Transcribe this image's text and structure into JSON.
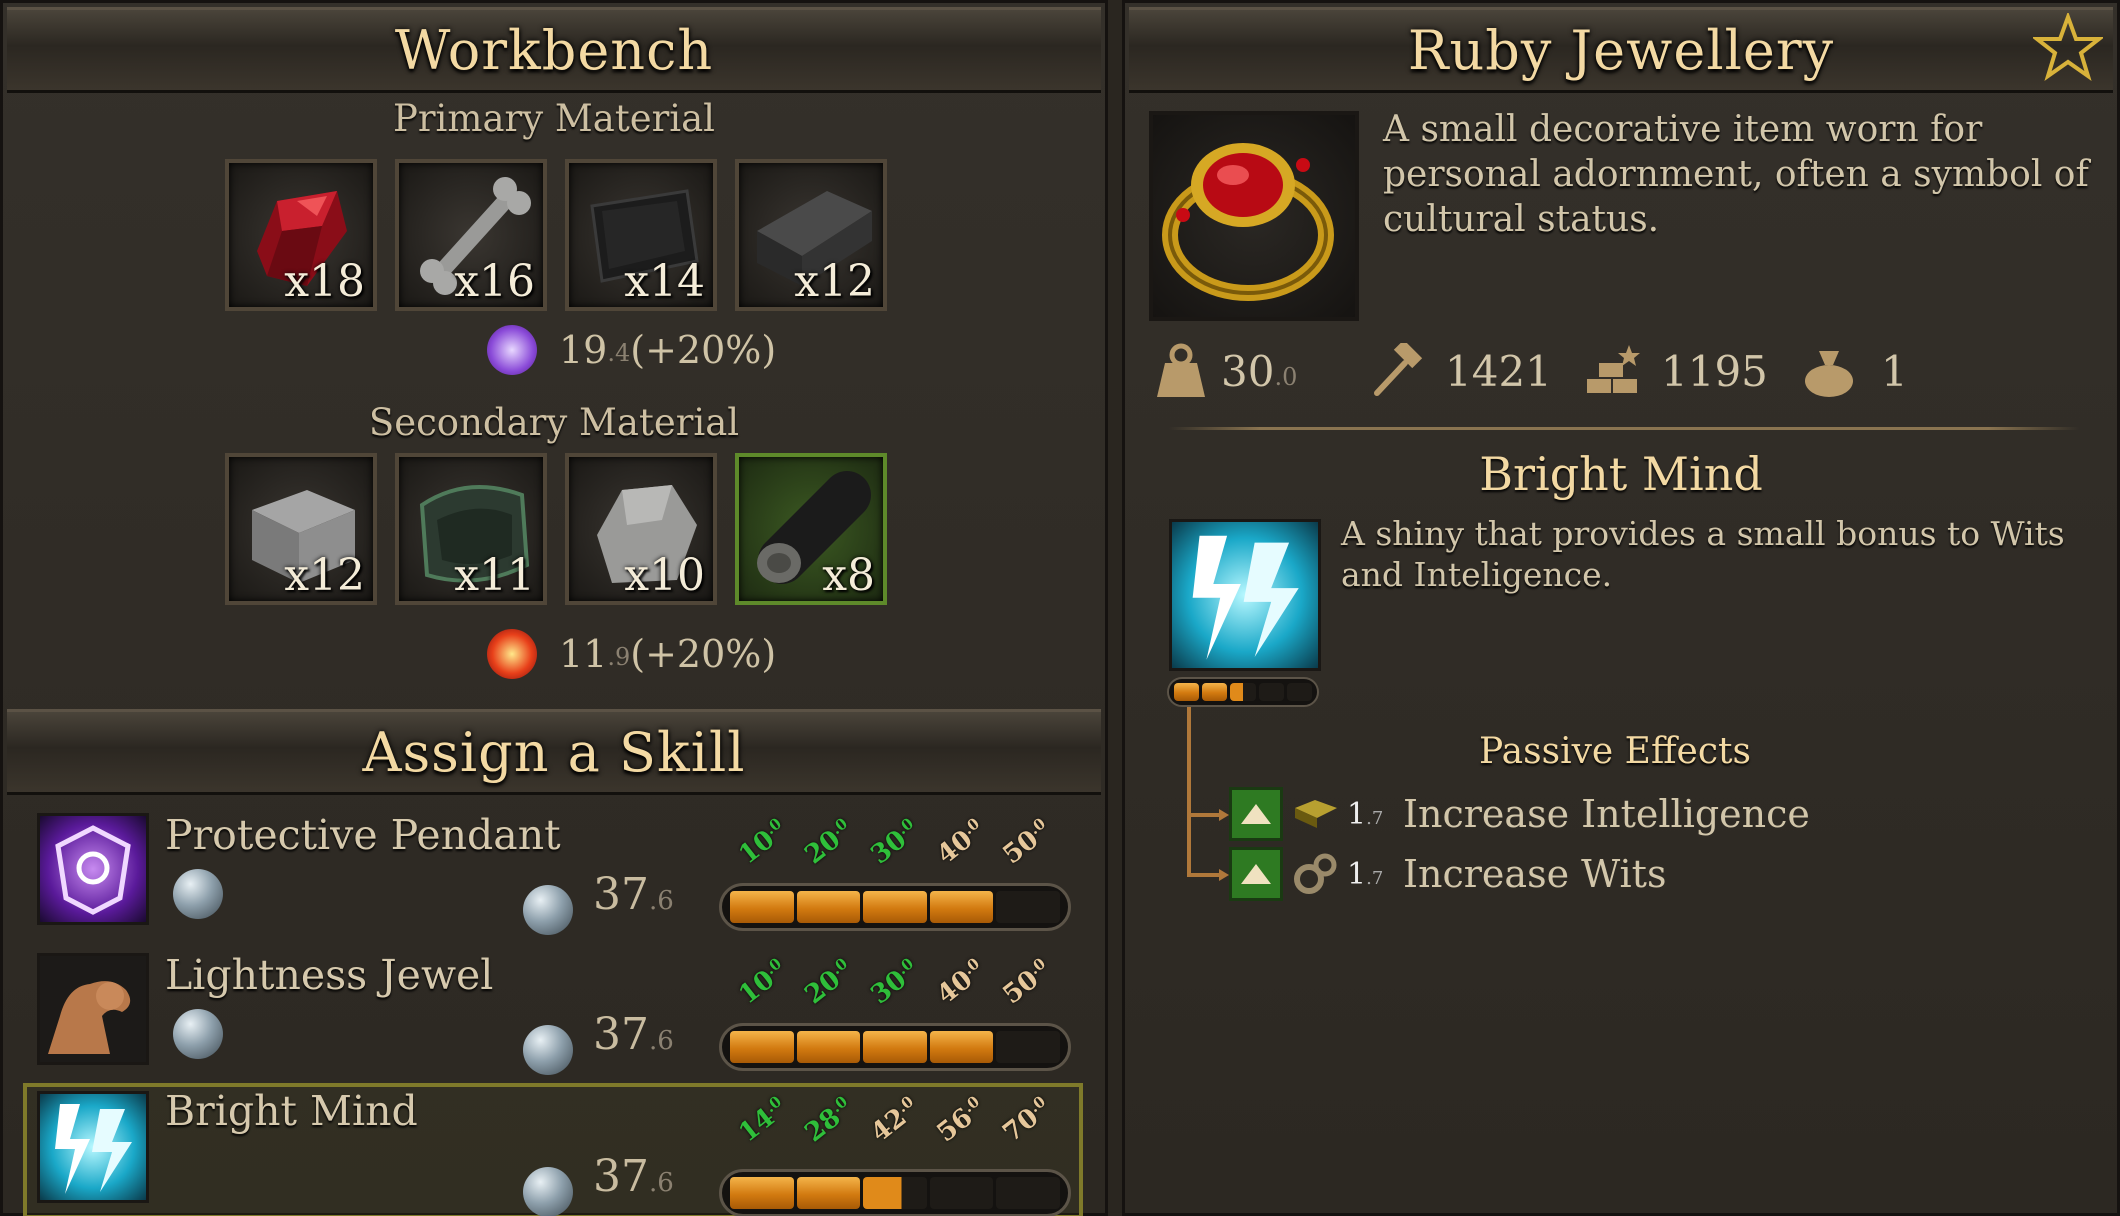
{
  "workbench": {
    "title": "Workbench",
    "primary": {
      "heading": "Primary Material",
      "slots": [
        {
          "icon": "ruby-gem-icon",
          "qty": "x18"
        },
        {
          "icon": "bone-icon",
          "qty": "x16"
        },
        {
          "icon": "dark-leather-icon",
          "qty": "x14"
        },
        {
          "icon": "iron-ingot-icon",
          "qty": "x12"
        }
      ],
      "stat_value": "19",
      "stat_decimal": ".4",
      "stat_bonus": "(+20%)"
    },
    "secondary": {
      "heading": "Secondary Material",
      "slots": [
        {
          "icon": "stone-block-icon",
          "qty": "x12"
        },
        {
          "icon": "cloth-scrap-icon",
          "qty": "x11"
        },
        {
          "icon": "rock-icon",
          "qty": "x10"
        },
        {
          "icon": "log-icon",
          "qty": "x8",
          "selected": true
        }
      ],
      "stat_value": "11",
      "stat_decimal": ".9",
      "stat_bonus": "(+20%)"
    }
  },
  "assign": {
    "title": "Assign a Skill",
    "skills": [
      {
        "name": "Protective Pendant",
        "icon": "pendant-icon",
        "value": "37",
        "value_decimal": ".6",
        "ticks": [
          "10",
          "20",
          "30",
          "40",
          "50"
        ],
        "tick_sup": ".0",
        "ticks_green": 3,
        "level": 4,
        "selected": false
      },
      {
        "name": "Lightness Jewel",
        "icon": "flexed-arm-icon",
        "value": "37",
        "value_decimal": ".6",
        "ticks": [
          "10",
          "20",
          "30",
          "40",
          "50"
        ],
        "tick_sup": ".0",
        "ticks_green": 3,
        "level": 4,
        "selected": false
      },
      {
        "name": "Bright Mind",
        "icon": "lightning-icon",
        "value": "37",
        "value_decimal": ".6",
        "ticks": [
          "14",
          "28",
          "42",
          "56",
          "70"
        ],
        "tick_sup": ".0",
        "ticks_green": 2,
        "level": 2.6,
        "selected": true
      }
    ]
  },
  "item": {
    "title": "Ruby Jewellery",
    "description": "A small decorative item worn for personal adornment, often a symbol of cultural status.",
    "stats": [
      {
        "icon": "weight-icon",
        "value": "30",
        "decimal": ".0"
      },
      {
        "icon": "hammer-icon",
        "value": "1421",
        "decimal": ""
      },
      {
        "icon": "gold-bars-icon",
        "value": "1195",
        "decimal": ""
      },
      {
        "icon": "coin-bag-icon",
        "value": "1",
        "decimal": ""
      }
    ],
    "skill": {
      "name": "Bright Mind",
      "description": "A shiny that provides a small bonus to Wits and Inteligence.",
      "progress": 0.5,
      "passive_heading": "Passive Effects",
      "effects": [
        {
          "icon": "book-icon",
          "value": "1",
          "decimal": ".7",
          "text": "Increase Intelligence"
        },
        {
          "icon": "gears-icon",
          "value": "1",
          "decimal": ".7",
          "text": "Increase Wits"
        }
      ]
    }
  },
  "colors": {
    "accent_gold": "#f3d9a3",
    "bar_orange": "#e08a1a",
    "tick_green": "#2fbf3a",
    "tick_tan": "#e6c79a"
  }
}
